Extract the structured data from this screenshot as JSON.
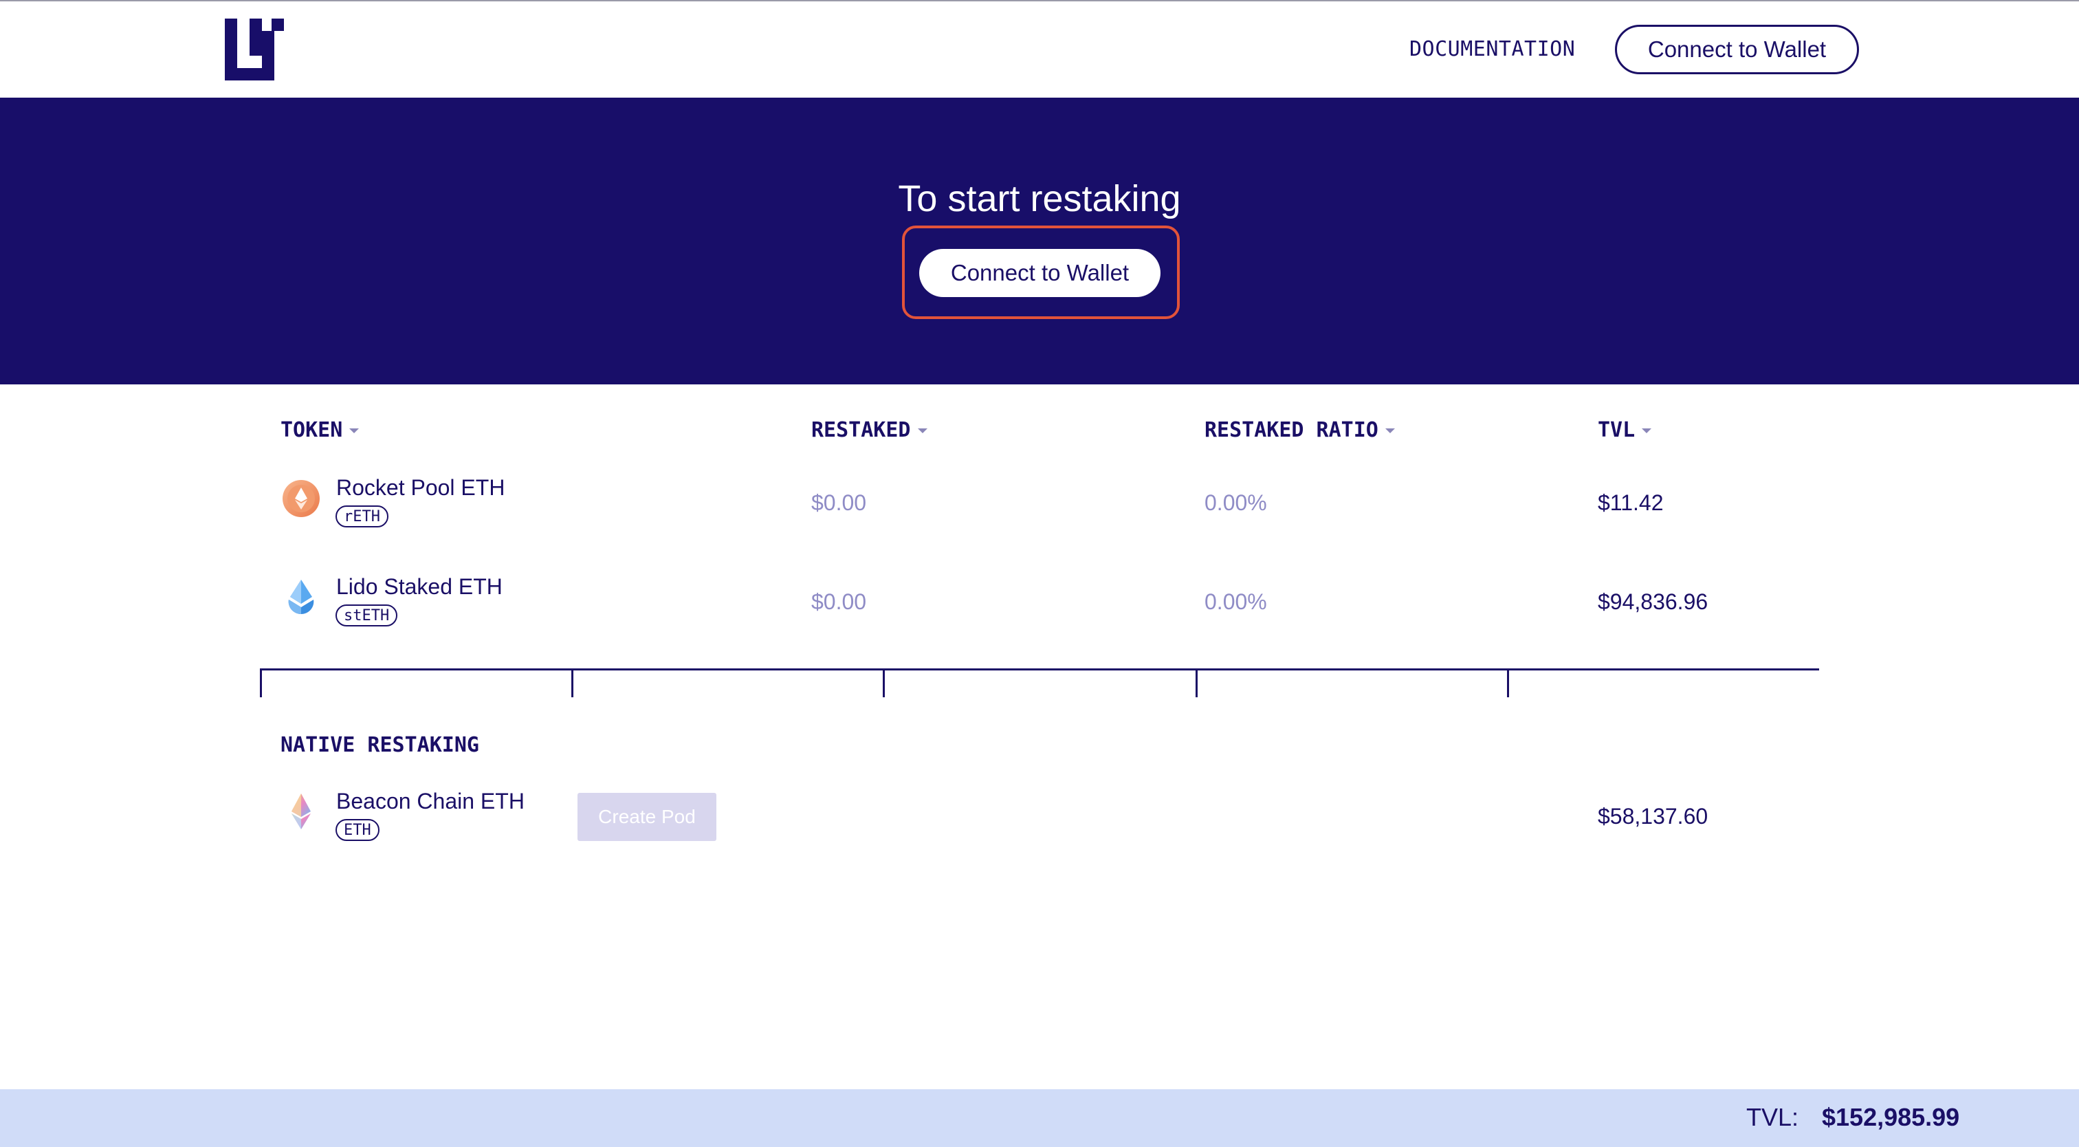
{
  "header": {
    "logo": "eigenlayer-logo-icon",
    "documentation_label": "DOCUMENTATION",
    "connect_label": "Connect to Wallet"
  },
  "hero": {
    "title": "To start restaking",
    "connect_label": "Connect to Wallet"
  },
  "table": {
    "columns": [
      "TOKEN",
      "RESTAKED",
      "RESTAKED RATIO",
      "TVL"
    ],
    "rows": [
      {
        "name": "Rocket Pool ETH",
        "symbol": "rETH",
        "icon": "rocket-pool-eth-icon",
        "restaked": "$0.00",
        "ratio": "0.00%",
        "tvl": "$11.42"
      },
      {
        "name": "Lido Staked ETH",
        "symbol": "stETH",
        "icon": "lido-steth-icon",
        "restaked": "$0.00",
        "ratio": "0.00%",
        "tvl": "$94,836.96"
      }
    ]
  },
  "native": {
    "title": "NATIVE RESTAKING",
    "name": "Beacon Chain ETH",
    "symbol": "ETH",
    "icon": "beacon-chain-eth-icon",
    "create_pod_label": "Create Pod",
    "tvl": "$58,137.60"
  },
  "footer": {
    "tvl_label": "TVL:",
    "tvl_value": "$152,985.99"
  },
  "colors": {
    "brand_navy": "#180e69",
    "highlight": "#e2533a",
    "footer_bg": "#d0dcf8",
    "muted_text": "#8f8cc6"
  }
}
